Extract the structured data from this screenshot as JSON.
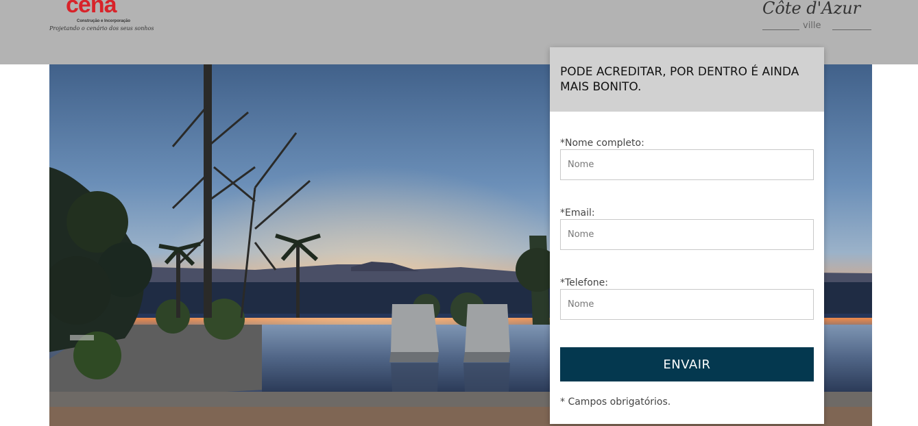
{
  "header": {
    "brand_left": {
      "name": "cena",
      "subtitle": "Construção e Incorporação",
      "slogan": "Projetando o cenário dos seus sonhos"
    },
    "brand_right": {
      "name": "Côte d'Azur",
      "subtitle": "ville"
    }
  },
  "hero": {
    "image": "sunset-infinity-pool-with-lounge-chairs"
  },
  "form": {
    "heading": "PODE ACREDITAR, POR DENTRO É AINDA MAIS BONITO.",
    "fields": [
      {
        "label": "*Nome completo:",
        "placeholder": "Nome",
        "value": ""
      },
      {
        "label": "*Email:",
        "placeholder": "Nome",
        "value": ""
      },
      {
        "label": "*Telefone:",
        "placeholder": "Nome",
        "value": ""
      }
    ],
    "submit_label": "ENVAIR",
    "required_note": "* Campos obrigatórios."
  },
  "colors": {
    "header_bg": "#b3b3b3",
    "brand_red": "#d8232a",
    "button_bg": "#04384f",
    "form_header_bg": "#d1d1d1",
    "bottom_strip": "#7f6654"
  }
}
